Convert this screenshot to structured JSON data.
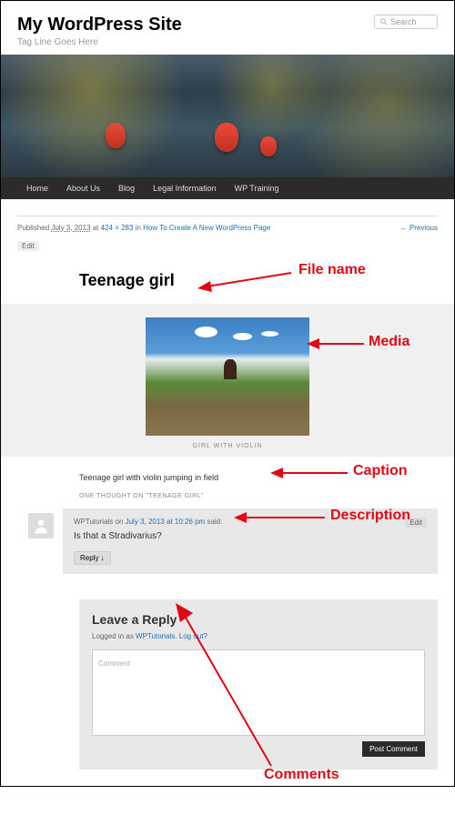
{
  "site": {
    "title": "My WordPress Site",
    "tagline": "Tag Line Goes Here"
  },
  "search": {
    "placeholder": "Search"
  },
  "nav": {
    "items": [
      "Home",
      "About Us",
      "Blog",
      "Legal Information",
      "WP Training"
    ]
  },
  "meta": {
    "published_label": "Published ",
    "date": "July 3, 2013",
    "at": " at ",
    "dims": "424 × 283",
    "in": " in ",
    "parent": "How To Create A New WordPress Page",
    "prev": "← Previous"
  },
  "edit": "Edit",
  "page_title": "Teenage girl",
  "caption": "GIRL WITH VIOLIN",
  "description": "Teenage girl with violin jumping in field",
  "thoughts": "ONE THOUGHT ON \"TEENAGE GIRL\"",
  "comment": {
    "author": "WPTutorials",
    "on": " on ",
    "date": "July 3, 2013 at 10:26 pm",
    "said": " said:",
    "text": "Is that a Stradivarius?",
    "reply": "Reply ↓",
    "edit": "Edit"
  },
  "reply": {
    "title": "Leave a Reply",
    "logged_pre": "Logged in as ",
    "user": "WPTutorials",
    "logout": "Log out?",
    "field_label": "Comment",
    "submit": "Post Comment"
  },
  "annotations": {
    "file_name": "File name",
    "media": "Media",
    "caption": "Caption",
    "description": "Description",
    "comments": "Comments"
  }
}
